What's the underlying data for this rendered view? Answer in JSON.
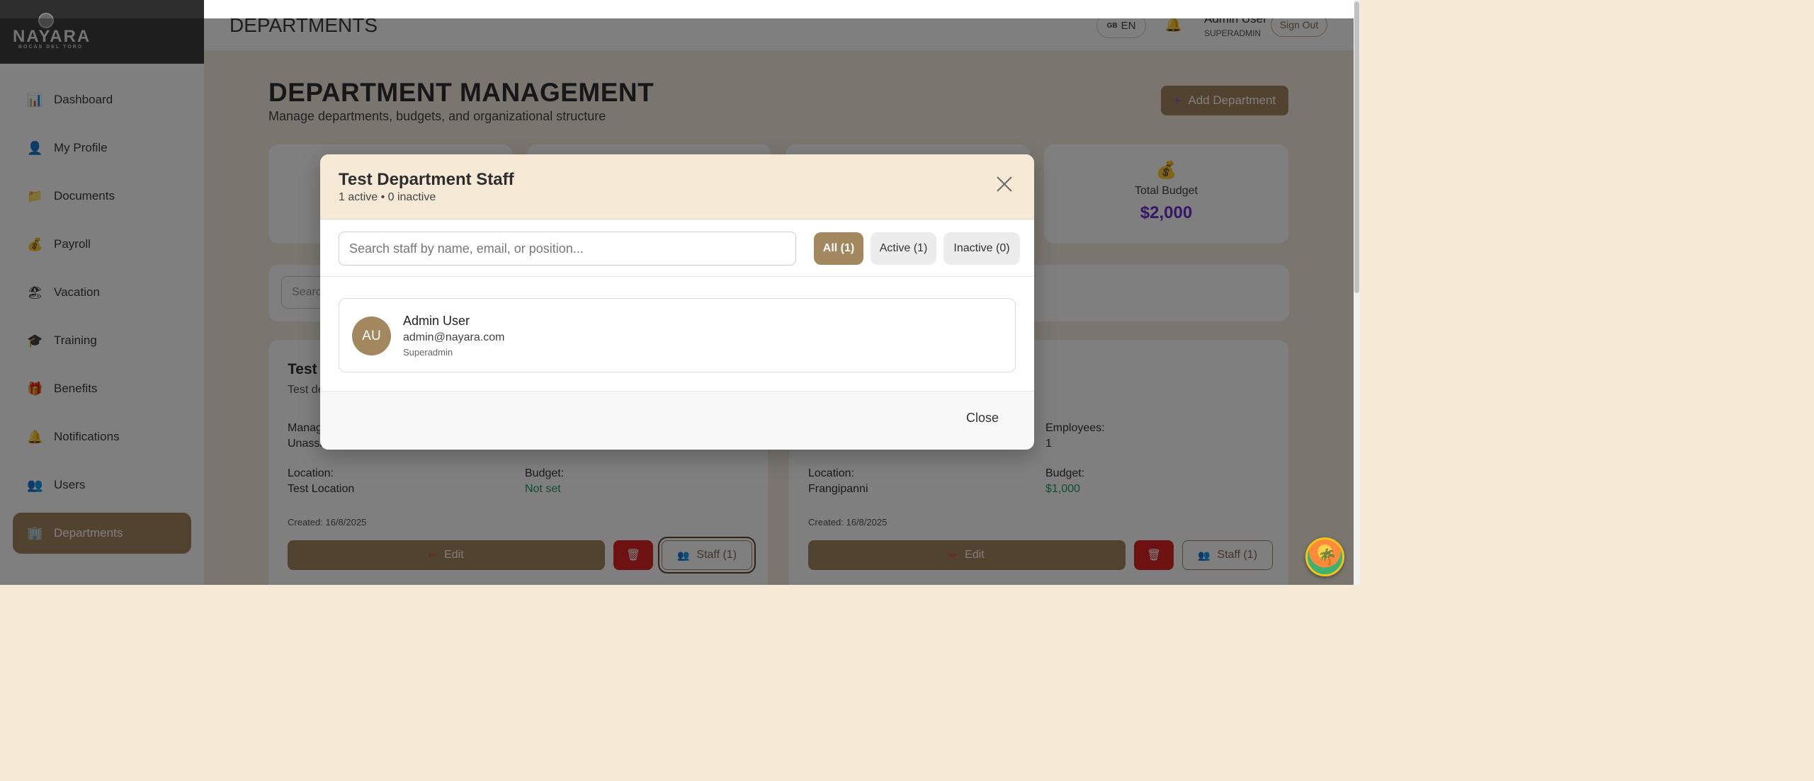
{
  "brand": {
    "name": "NAYARA",
    "tagline": "BOCAS DEL TORO"
  },
  "sidebar": {
    "items": [
      {
        "label": "Dashboard",
        "icon": "📊"
      },
      {
        "label": "My Profile",
        "icon": "👤"
      },
      {
        "label": "Documents",
        "icon": "📁"
      },
      {
        "label": "Payroll",
        "icon": "💰"
      },
      {
        "label": "Vacation",
        "icon": "🏖"
      },
      {
        "label": "Training",
        "icon": "🎓"
      },
      {
        "label": "Benefits",
        "icon": "🎁"
      },
      {
        "label": "Notifications",
        "icon": "🔔"
      },
      {
        "label": "Users",
        "icon": "👥"
      },
      {
        "label": "Departments",
        "icon": "🏢"
      }
    ],
    "active": "Departments"
  },
  "header": {
    "title": "DEPARTMENTS",
    "lang_flag": "GB",
    "lang": "EN",
    "bell_icon": "🔔",
    "user_name": "Admin User",
    "user_role": "SUPERADMIN",
    "sign_out": "Sign Out"
  },
  "page": {
    "title": "DEPARTMENT MANAGEMENT",
    "subtitle": "Manage departments, budgets, and organizational structure",
    "add_button": "Add Department",
    "add_icon": "+"
  },
  "stats": [
    {
      "icon": "💰",
      "label": "Total Budget",
      "value": "$2,000"
    }
  ],
  "search_bg_placeholder": "Search",
  "departments": [
    {
      "name": "Test",
      "description": "Test de",
      "manager_label": "Manag",
      "manager_value": "Unassi",
      "location_label": "Location:",
      "location_value": "Test Location",
      "budget_label": "Budget:",
      "budget_value": "Not set",
      "created": "Created: 16/8/2025",
      "edit": "Edit",
      "delete_icon": "🗑",
      "staff": "Staff (1)"
    },
    {
      "employees_label": "Employees:",
      "employees_value": "1",
      "location_label": "Location:",
      "location_value": "Frangipanni",
      "budget_label": "Budget:",
      "budget_value": "$1,000",
      "created": "Created: 16/8/2025",
      "edit": "Edit",
      "delete_icon": "🗑",
      "staff": "Staff (1)"
    }
  ],
  "modal": {
    "title": "Test Department Staff",
    "subtitle": "1 active • 0 inactive",
    "search_placeholder": "Search staff by name, email, or position...",
    "filters": [
      {
        "label": "All (1)",
        "active": true
      },
      {
        "label": "Active (1)",
        "active": false
      },
      {
        "label": "Inactive (0)",
        "active": false
      }
    ],
    "staff": [
      {
        "initials": "AU",
        "name": "Admin User",
        "email": "admin@nayara.com",
        "position": "Superadmin"
      }
    ],
    "close": "Close"
  },
  "colors": {
    "accent": "#a3875f",
    "page_bg": "#f6ead6",
    "danger": "#dd2222",
    "budget_purple": "#6b2fd0",
    "success_green": "#1f9d57"
  }
}
